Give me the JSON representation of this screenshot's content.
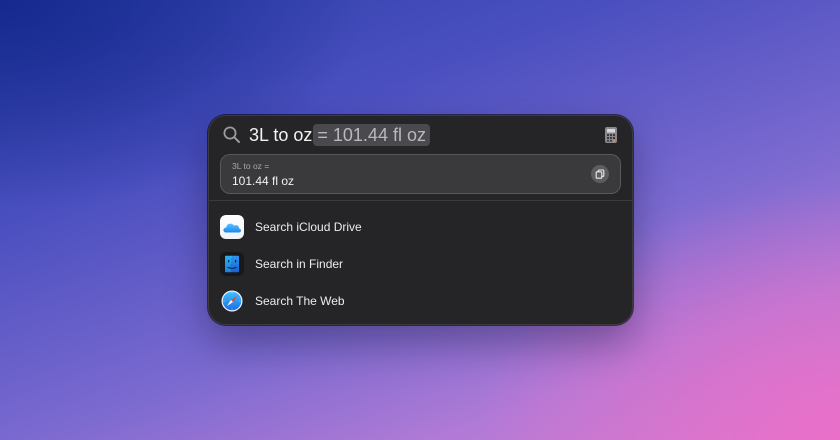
{
  "spotlight": {
    "query": "3L to oz",
    "inline_result": "= 101.44 fl oz",
    "search_icon": "magnifying-glass-icon",
    "calculator_icon": "calculator-icon",
    "result_card": {
      "label": "3L to oz =",
      "value": "101.44 fl oz",
      "copy_icon": "copy-icon"
    },
    "results": [
      {
        "label": "Search iCloud Drive",
        "icon": "icloud-drive-icon"
      },
      {
        "label": "Search in Finder",
        "icon": "finder-icon"
      },
      {
        "label": "Search The Web",
        "icon": "safari-icon"
      }
    ]
  },
  "colors": {
    "panel": "#252527",
    "card": "#3a3a3d",
    "text": "#f2f2f2",
    "muted": "#b9b9bd"
  }
}
